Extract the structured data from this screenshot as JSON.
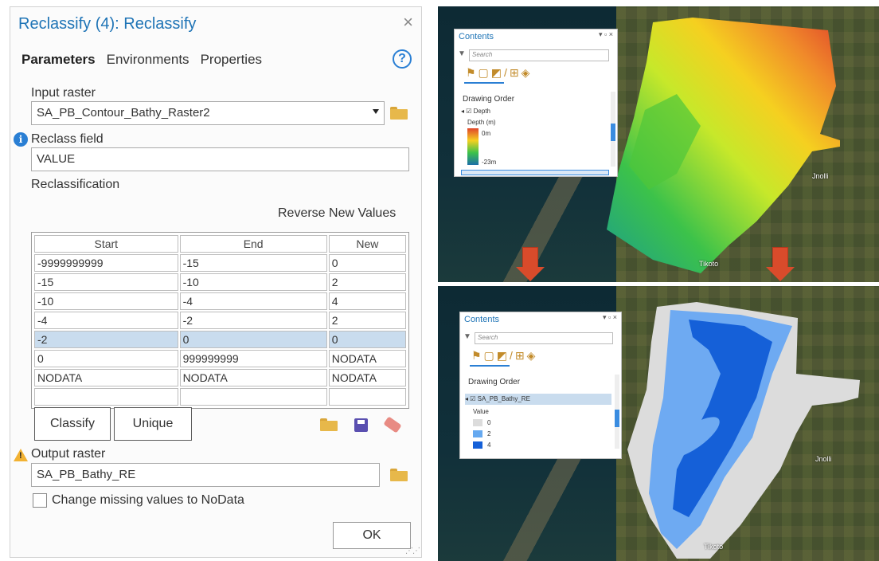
{
  "dialog": {
    "title": "Reclassify (4): Reclassify",
    "close_glyph": "×",
    "tabs": [
      "Parameters",
      "Environments",
      "Properties"
    ],
    "help_glyph": "?",
    "input_raster": {
      "label": "Input raster",
      "value": "SA_PB_Contour_Bathy_Raster2"
    },
    "reclass_field": {
      "label": "Reclass field",
      "value": "VALUE"
    },
    "reclassification_label": "Reclassification",
    "reverse_label": "Reverse New Values",
    "table": {
      "headers": [
        "Start",
        "End",
        "New"
      ],
      "rows": [
        [
          "-9999999999",
          "-15",
          "0"
        ],
        [
          "-15",
          "-10",
          "2"
        ],
        [
          "-10",
          "-4",
          "4"
        ],
        [
          "-4",
          "-2",
          "2"
        ],
        [
          "-2",
          "0",
          "0"
        ],
        [
          "0",
          "999999999",
          "NODATA"
        ],
        [
          "NODATA",
          "NODATA",
          "NODATA"
        ],
        [
          "",
          "",
          ""
        ]
      ],
      "selected_row": 4
    },
    "classify_label": "Classify",
    "unique_label": "Unique",
    "output_raster": {
      "label": "Output raster",
      "value": "SA_PB_Bathy_RE"
    },
    "change_missing_label": "Change missing values to NoData",
    "ok_label": "OK"
  },
  "maps": {
    "top": {
      "contents_title": "Contents",
      "search_placeholder": "Search",
      "drawing_order": "Drawing Order",
      "layer_name": "Depth",
      "legend_title": "Depth (m)",
      "legend_max": "0m",
      "legend_min": "-23m",
      "place_1": "Jnolli",
      "place_2": "Tikoto"
    },
    "bottom": {
      "contents_title": "Contents",
      "search_placeholder": "Search",
      "drawing_order": "Drawing Order",
      "layer_name": "SA_PB_Bathy_RE",
      "legend_title": "Value",
      "legend_items": [
        {
          "label": "0",
          "color": "#dcdcdc"
        },
        {
          "label": "2",
          "color": "#66a9f0"
        },
        {
          "label": "4",
          "color": "#1560d8"
        }
      ],
      "place_1": "Jnolli",
      "place_2": "Tikoto"
    }
  },
  "colors": {
    "accent": "#1f74b6",
    "arrow": "#d94b2b",
    "class_0": "#dcdcdc",
    "class_2": "#6eaaf2",
    "class_4": "#1560d8"
  }
}
